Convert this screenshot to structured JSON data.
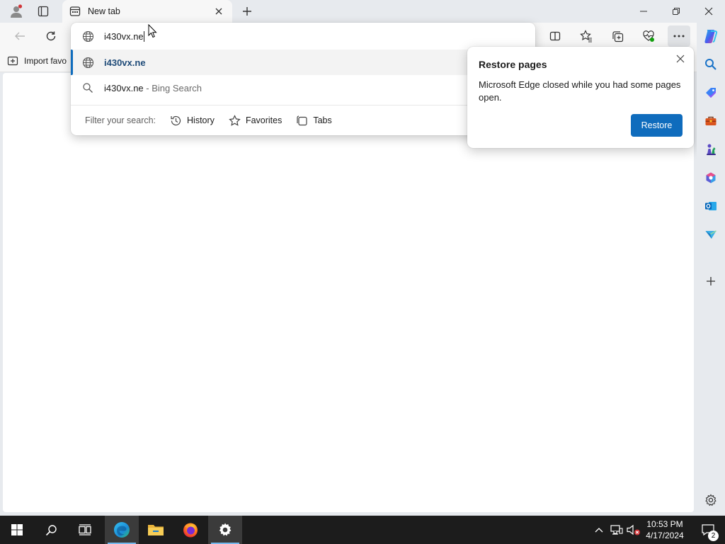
{
  "tab": {
    "title": "New tab"
  },
  "favorites_bar": {
    "import_label": "Import favo"
  },
  "omnibox": {
    "typed_text": "i430vx.ne",
    "suggestions": [
      {
        "text": "i430vx.ne",
        "sub": "",
        "icon": "globe-icon"
      },
      {
        "text": "i430vx.ne",
        "sub": " - Bing Search",
        "icon": "search-icon"
      }
    ],
    "filter": {
      "label": "Filter your search:",
      "options": [
        "History",
        "Favorites",
        "Tabs"
      ]
    }
  },
  "restore_popup": {
    "title": "Restore pages",
    "message": "Microsoft Edge closed while you had some pages open.",
    "button_label": "Restore"
  },
  "taskbar": {
    "time": "10:53 PM",
    "date": "4/17/2024",
    "notification_count": "2"
  },
  "colors": {
    "accent": "#0f6cbd",
    "chrome_bg": "#e7eaee",
    "taskbar_bg": "#1c1c1c"
  }
}
